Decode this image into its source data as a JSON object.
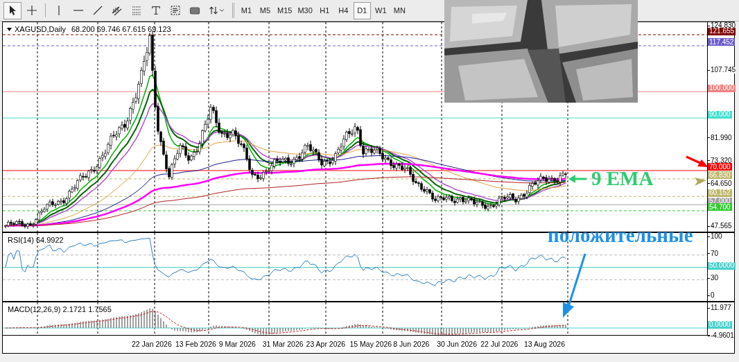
{
  "toolbar": {
    "tools": [
      {
        "kind": "cursor",
        "selected": true
      },
      {
        "kind": "crosshair",
        "selected": false
      },
      {
        "kind": "vline",
        "selected": false
      },
      {
        "kind": "hline",
        "selected": false
      },
      {
        "kind": "trend",
        "selected": false
      },
      {
        "kind": "channel",
        "selected": false
      },
      {
        "kind": "fibo",
        "selected": false
      },
      {
        "kind": "text",
        "selected": false
      },
      {
        "kind": "label",
        "selected": false
      },
      {
        "kind": "rect",
        "selected": false
      },
      {
        "kind": "arrows",
        "selected": false
      }
    ],
    "timeframes": [
      {
        "label": "M1",
        "selected": false
      },
      {
        "label": "M5",
        "selected": false
      },
      {
        "label": "M15",
        "selected": false
      },
      {
        "label": "M30",
        "selected": false
      },
      {
        "label": "H1",
        "selected": false
      },
      {
        "label": "H4",
        "selected": false
      },
      {
        "label": "D1",
        "selected": true
      },
      {
        "label": "W1",
        "selected": false
      },
      {
        "label": "MN",
        "selected": false
      }
    ]
  },
  "chart": {
    "symbol": "XAGUSD,Daily",
    "ohlc": "68.200 69.746 67.615 69.123",
    "price_scale": [
      "124.830",
      "107.745",
      "81.990",
      "73.320",
      "64.650",
      "47.565"
    ],
    "levels": [
      {
        "label": "121.655",
        "color": "#800000",
        "kind": "dashed"
      },
      {
        "label": "117.452",
        "color": "#6a5acd",
        "kind": "dashed"
      },
      {
        "label": "100.000",
        "color": "#f08080",
        "kind": "solid"
      },
      {
        "label": "90.000",
        "color": "#40e0d0",
        "kind": "solid"
      },
      {
        "label": "70.000",
        "color": "#ff0000",
        "kind": "solid"
      },
      {
        "label": "66.830",
        "color": "#bdb76b",
        "kind": "dashed"
      },
      {
        "label": "60.152",
        "color": "#bdb76b",
        "kind": "dashed"
      },
      {
        "label": "57.000",
        "color": "#a0a0a0",
        "kind": "solid"
      },
      {
        "label": "54.700",
        "color": "#32cd32",
        "kind": "dashed"
      }
    ]
  },
  "rsi": {
    "title": "RSI(14) 64.9922",
    "scale": [
      "100",
      "70",
      "30",
      "0"
    ],
    "level": {
      "label": "50.0000",
      "color": "#48d1cc"
    }
  },
  "macd": {
    "title": "MACD(12,26,9) 2.1721 1.7565",
    "scale": [
      "11.977",
      "-4.9601"
    ],
    "level": {
      "label": "0.0000",
      "color": "#48d1cc"
    }
  },
  "time_scale": [
    "22 Jan 2026",
    "13 Feb 2026",
    "9 Mar 2026",
    "31 Mar 2026",
    "23 Apr 2026",
    "15 May 2026",
    "8 Jun 2026",
    "30 Jun 2026",
    "22 Jul 2026",
    "13 Aug 2026"
  ],
  "annotations": [
    {
      "kind": "ema",
      "text": "9 EMA",
      "color": "#2ecc71"
    },
    {
      "kind": "trend",
      "text": "положительные",
      "color": "#1e90e8"
    }
  ]
}
